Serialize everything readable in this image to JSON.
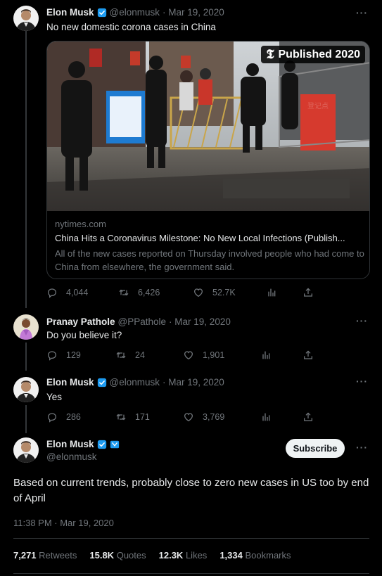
{
  "tweet1": {
    "name": "Elon Musk",
    "handle": "@elonmusk",
    "date": "· Mar 19, 2020",
    "text": "No new domestic corona cases in China",
    "card": {
      "badge": "Published 2020",
      "domain": "nytimes.com",
      "title": "China Hits a Coronavirus Milestone: No New Local Infections (Publish...",
      "description": "All of the new cases reported on Thursday involved people who had come to China from elsewhere, the government said.",
      "sign_text": "登记点"
    },
    "replies": "4,044",
    "retweets": "6,426",
    "likes": "52.7K"
  },
  "tweet2": {
    "name": "Pranay Pathole",
    "handle": "@PPathole",
    "date": "· Mar 19, 2020",
    "text": "Do you believe it?",
    "replies": "129",
    "retweets": "24",
    "likes": "1,901"
  },
  "tweet3": {
    "name": "Elon Musk",
    "handle": "@elonmusk",
    "date": "· Mar 19, 2020",
    "text": "Yes",
    "replies": "286",
    "retweets": "171",
    "likes": "3,769"
  },
  "main": {
    "name": "Elon Musk",
    "handle": "@elonmusk",
    "subscribe_label": "Subscribe",
    "text": "Based on current trends, probably close to zero new cases in US too by end of April",
    "timestamp": "11:38 PM · Mar 19, 2020",
    "stats": {
      "retweets_count": "7,271",
      "retweets_label": "Retweets",
      "quotes_count": "15.8K",
      "quotes_label": "Quotes",
      "likes_count": "12.3K",
      "likes_label": "Likes",
      "bookmarks_count": "1,334",
      "bookmarks_label": "Bookmarks"
    }
  },
  "more_label": "···",
  "colors": {
    "background": "#000000",
    "text_primary": "#e7e9ea",
    "text_secondary": "#71767b",
    "verified_blue": "#1d9bf0",
    "border": "#2f3336"
  },
  "icons": [
    "reply-icon",
    "retweet-icon",
    "like-icon",
    "views-icon",
    "share-icon",
    "verified-badge-icon",
    "more-icon"
  ]
}
